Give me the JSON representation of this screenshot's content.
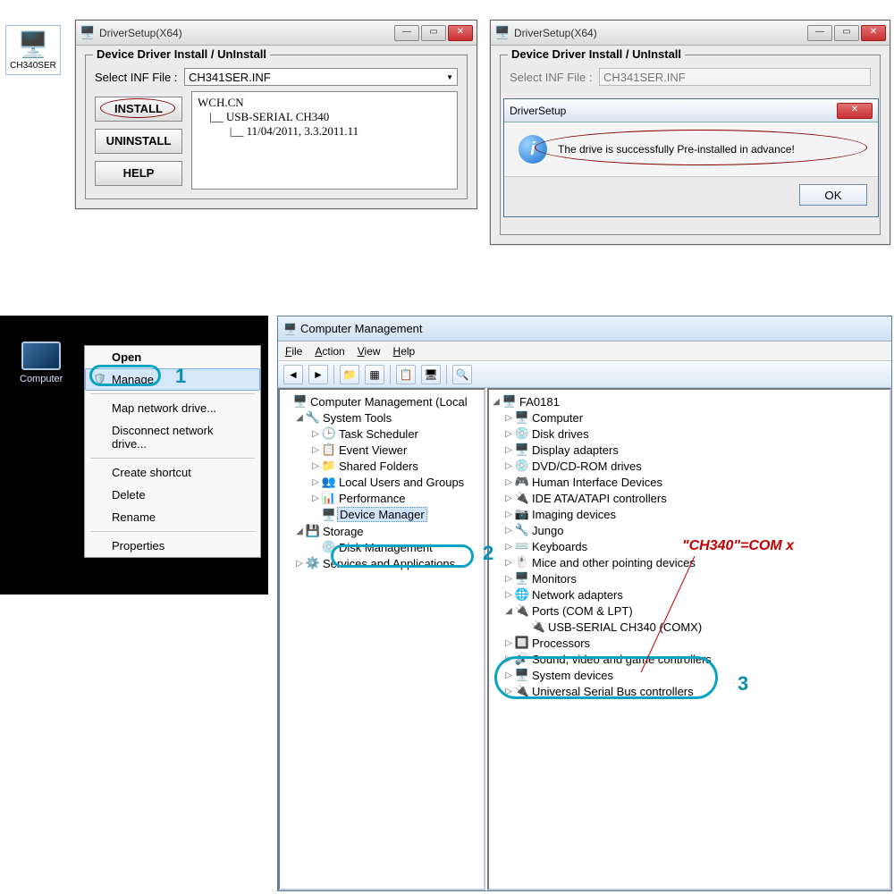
{
  "desktopIcon": {
    "label": "CH340SER"
  },
  "driverSetup1": {
    "title": "DriverSetup(X64)",
    "groupTitle": "Device Driver Install / UnInstall",
    "selectLabel": "Select INF File :",
    "selectValue": "CH341SER.INF",
    "buttons": {
      "install": "INSTALL",
      "uninstall": "UNINSTALL",
      "help": "HELP"
    },
    "info": "WCH.CN\n    |__ USB-SERIAL CH340\n           |__ 11/04/2011, 3.3.2011.11"
  },
  "driverSetup2": {
    "title": "DriverSetup(X64)",
    "groupTitle": "Device Driver Install / UnInstall",
    "selectLabel": "Select INF File :",
    "selectValue": "CH341SER.INF"
  },
  "popup": {
    "title": "DriverSetup",
    "message": "The drive is successfully Pre-installed in advance!",
    "ok": "OK"
  },
  "contextMenu": {
    "computerLabel": "Computer",
    "items": {
      "open": "Open",
      "manage": "Manage",
      "mapDrive": "Map network drive...",
      "disconnect": "Disconnect network drive...",
      "shortcut": "Create shortcut",
      "delete": "Delete",
      "rename": "Rename",
      "properties": "Properties"
    },
    "step1": "1"
  },
  "cm": {
    "title": "Computer Management",
    "menu": {
      "file": "File",
      "action": "Action",
      "view": "View",
      "help": "Help"
    },
    "leftTree": {
      "root": "Computer Management (Local",
      "systemTools": "System Tools",
      "taskScheduler": "Task Scheduler",
      "eventViewer": "Event Viewer",
      "sharedFolders": "Shared Folders",
      "localUsers": "Local Users and Groups",
      "performance": "Performance",
      "deviceManager": "Device Manager",
      "storage": "Storage",
      "diskManagement": "Disk Management",
      "services": "Services and Applications"
    },
    "rightTree": {
      "root": "FA0181",
      "computer": "Computer",
      "diskDrives": "Disk drives",
      "displayAdapters": "Display adapters",
      "dvd": "DVD/CD-ROM drives",
      "hid": "Human Interface Devices",
      "ide": "IDE ATA/ATAPI controllers",
      "imaging": "Imaging devices",
      "jungo": "Jungo",
      "keyboards": "Keyboards",
      "mice": "Mice and other pointing devices",
      "monitors": "Monitors",
      "network": "Network adapters",
      "ports": "Ports (COM & LPT)",
      "ch340": "USB-SERIAL CH340 (COMX)",
      "processors": "Processors",
      "sound": "Sound, video and game controllers",
      "systemDevices": "System devices",
      "usb": "Universal Serial Bus controllers"
    },
    "step2": "2",
    "step3": "3",
    "annotation": "\"CH340\"=COM x"
  }
}
